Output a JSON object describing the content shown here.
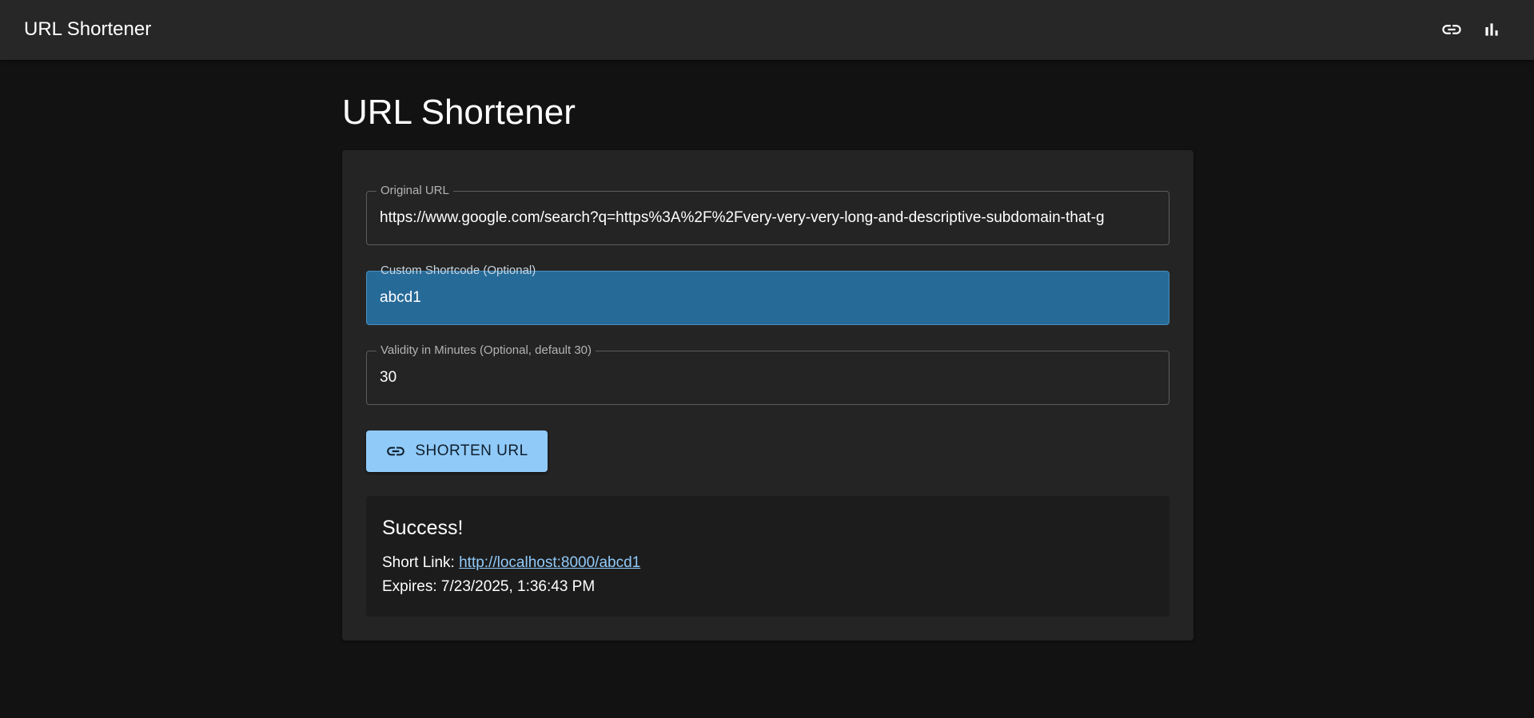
{
  "appbar": {
    "title": "URL Shortener",
    "icons": [
      "link-icon",
      "bar-chart-icon"
    ]
  },
  "main": {
    "page_title": "URL Shortener",
    "form": {
      "original_url": {
        "label": "Original URL",
        "value": "https://www.google.com/search?q=https%3A%2F%2Fvery-very-very-long-and-descriptive-subdomain-that-g"
      },
      "shortcode": {
        "label": "Custom Shortcode (Optional)",
        "value": "abcd1"
      },
      "validity": {
        "label": "Validity in Minutes (Optional, default 30)",
        "value": "30"
      },
      "submit_label": "SHORTEN URL"
    },
    "result": {
      "title": "Success!",
      "short_link_label": "Short Link:",
      "short_link_url": "http://localhost:8000/abcd1",
      "expires_label": "Expires:",
      "expires_value": "7/23/2025, 1:36:43 PM"
    }
  },
  "colors": {
    "background": "#121212",
    "appbar": "#272727",
    "card": "#242424",
    "accent": "#90caf9",
    "focused_field": "#266a98"
  }
}
